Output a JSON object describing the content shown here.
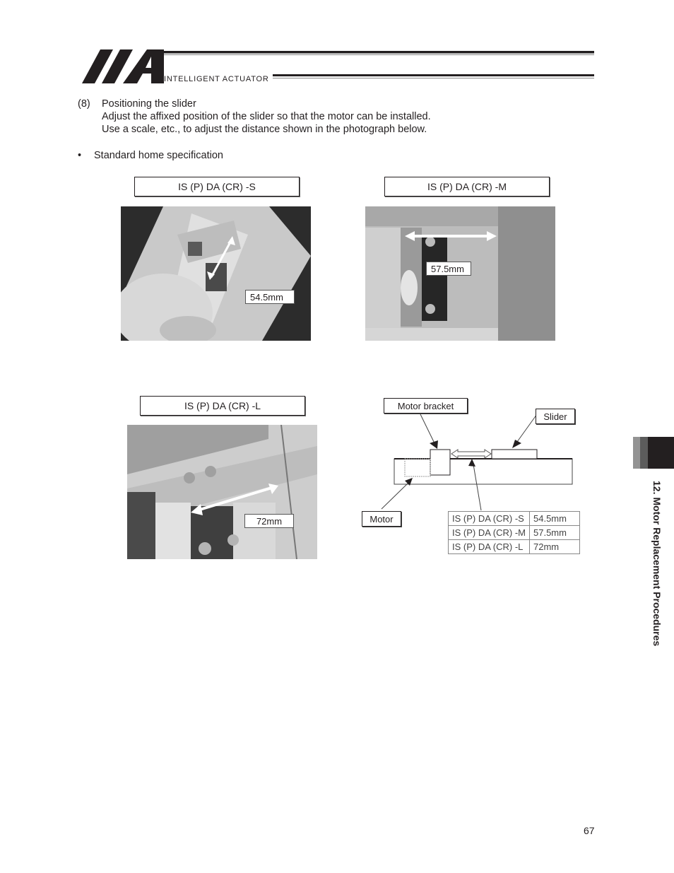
{
  "header": {
    "brand_text": "INTELLIGENT ACTUATOR",
    "logo_icon": "iai-logo-icon"
  },
  "section": {
    "number": "(8)",
    "title": "Positioning the slider",
    "lines": [
      "Adjust the affixed position of the slider so that the motor can be installed.",
      "Use a scale, etc., to adjust the distance shown in the photograph below."
    ]
  },
  "bullet": {
    "text": "Standard home specification"
  },
  "photos": [
    {
      "caption": "IS (P) DA (CR) -S",
      "measurement": "54.5mm"
    },
    {
      "caption": "IS (P) DA (CR) -M",
      "measurement": "57.5mm"
    },
    {
      "caption": "IS (P) DA (CR) -L",
      "measurement": "72mm"
    }
  ],
  "diagram": {
    "labels": {
      "motor_bracket": "Motor bracket",
      "slider": "Slider",
      "motor": "Motor"
    },
    "table": [
      {
        "model": "IS (P) DA (CR) -S",
        "distance": "54.5mm"
      },
      {
        "model": "IS (P) DA (CR) -M",
        "distance": "57.5mm"
      },
      {
        "model": "IS (P) DA (CR) -L",
        "distance": "72mm"
      }
    ]
  },
  "side_tab": {
    "title": "12. Motor Replacement Procedures"
  },
  "footer": {
    "page_number": "67"
  }
}
